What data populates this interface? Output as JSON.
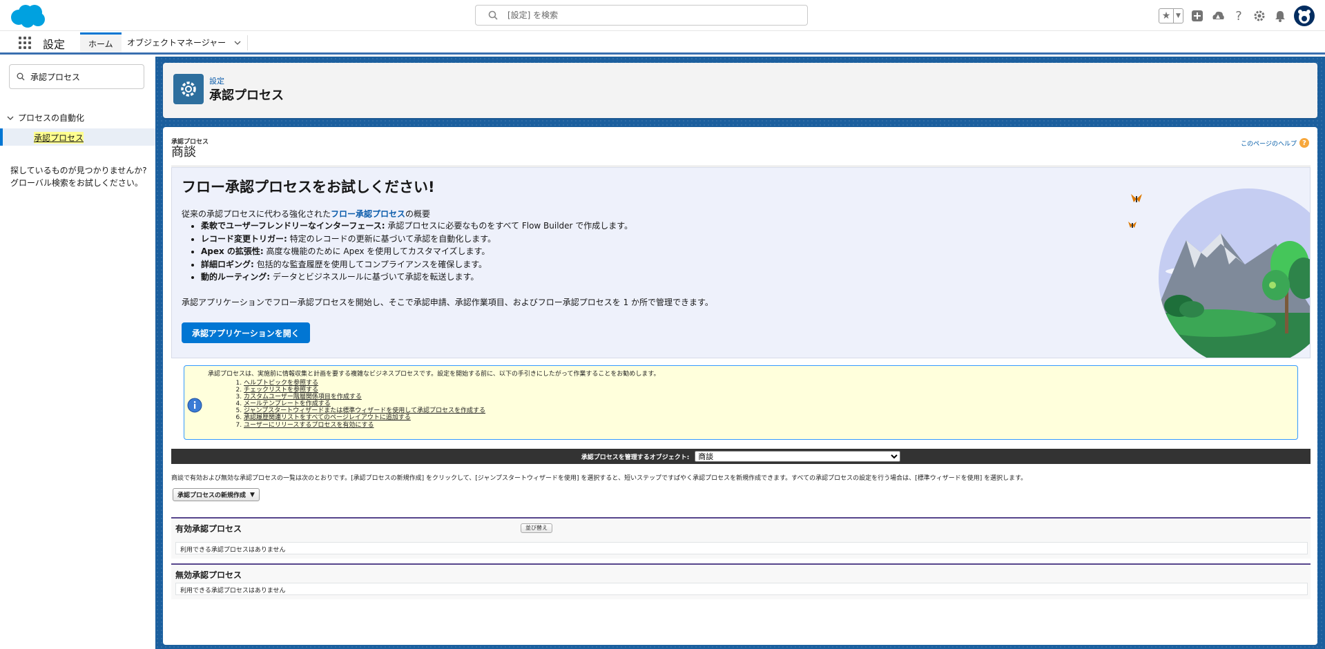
{
  "header": {
    "search_placeholder": "[設定] を検索",
    "colors": {
      "brand": "#00a1e0",
      "accent": "#0176d3"
    },
    "icons": [
      "star-icon",
      "chevron-down-icon",
      "plus-icon",
      "trailhead-icon",
      "help-icon",
      "gear-icon",
      "bell-icon",
      "avatar"
    ]
  },
  "context_bar": {
    "app_name": "設定",
    "tabs": [
      {
        "label": "ホーム"
      },
      {
        "label": "オブジェクトマネージャー"
      }
    ]
  },
  "sidebar": {
    "search_value": "承認プロセス",
    "group_label": "プロセスの自動化",
    "item_label": "承認プロセス",
    "help_line1": "探しているものが見つかりませんか?",
    "help_line2": "グローバル検索をお試しください。"
  },
  "page_header": {
    "eyebrow": "設定",
    "title": "承認プロセス"
  },
  "content": {
    "breadcrumb_small": "承認プロセス",
    "breadcrumb_large": "商談",
    "help_link": "このページのヘルプ",
    "banner": {
      "title": "フロー承認プロセスをお試しください!",
      "intro_before": "従来の承認プロセスに代わる強化された",
      "intro_link": "フロー承認プロセス",
      "intro_after": "の概要",
      "bullets": [
        {
          "bold": "柔軟でユーザーフレンドリーなインターフェース:",
          "text": " 承認プロセスに必要なものをすべて Flow Builder で作成します。"
        },
        {
          "bold": "レコード変更トリガー:",
          "text": " 特定のレコードの更新に基づいて承認を自動化します。"
        },
        {
          "bold": "Apex の拡張性:",
          "text": " 高度な機能のために Apex を使用してカスタマイズします。"
        },
        {
          "bold": "詳細ロギング:",
          "text": " 包括的な監査履歴を使用してコンプライアンスを確保します。"
        },
        {
          "bold": "動的ルーティング:",
          "text": " データとビジネスルールに基づいて承認を転送します。"
        }
      ],
      "summary": "承認アプリケーションでフロー承認プロセスを開始し、そこで承認申請、承認作業項目、およびフロー承認プロセスを 1 か所で管理できます。",
      "button_label": "承認アプリケーションを開く"
    },
    "info": {
      "text": "承認プロセスは、実施前に情報収集と計画を要する複雑なビジネスプロセスです。設定を開始する前に、以下の手引きにしたがって作業することをお勧めします。",
      "steps": [
        "ヘルプトピックを参照する",
        "チェックリストを参照する",
        "カスタムユーザー階層関係項目を作成する",
        "メールテンプレートを作成する",
        "ジャンプスタートウィザードまたは標準ウィザードを使用して承認プロセスを作成する",
        "承認履歴関連リストをすべてのページレイアウトに追加する",
        "ユーザーにリリースするプロセスを有効にする"
      ]
    },
    "object_selector": {
      "label": "承認プロセスを管理するオブジェクト:",
      "value": "商談"
    },
    "description": "商談で有効および無効な承認プロセスの一覧は次のとおりです。[承認プロセスの新規作成] をクリックして、[ジャンプスタートウィザードを使用] を選択すると、短いステップですばやく承認プロセスを新規作成できます。すべての承認プロセスの設定を行う場合は、[標準ウィザードを使用] を選択します。",
    "new_button_label": "承認プロセスの新規作成",
    "active": {
      "title": "有効承認プロセス",
      "sort_label": "並び替え",
      "empty_text": "利用できる承認プロセスはありません"
    },
    "inactive": {
      "title": "無効承認プロセス",
      "empty_text": "利用できる承認プロセスはありません"
    }
  }
}
